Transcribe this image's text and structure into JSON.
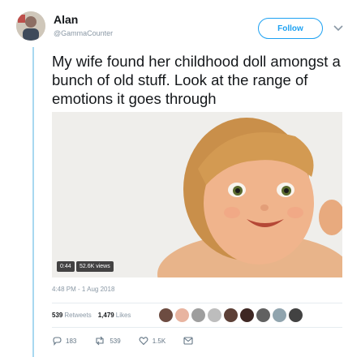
{
  "user": {
    "name": "Alan",
    "handle": "@GammaCounter"
  },
  "follow_label": "Follow",
  "tweet": {
    "text": "My wife found her childhood doll amongst a bunch of old stuff. Look at the range of emotions it goes through"
  },
  "video": {
    "duration": "0:44",
    "views": "52.6K views"
  },
  "timestamp": "4:48 PM - 1 Aug 2018",
  "stats": {
    "retweets_count": "539",
    "retweets_label": "Retweets",
    "likes_count": "1,479",
    "likes_label": "Likes"
  },
  "likers": [
    {
      "color": "#6d4c41"
    },
    {
      "color": "#e8b4a0"
    },
    {
      "color": "#9e9e9e"
    },
    {
      "color": "#bdbdbd"
    },
    {
      "color": "#5d4037"
    },
    {
      "color": "#3e2723"
    },
    {
      "color": "#616161"
    },
    {
      "color": "#90a4ae"
    },
    {
      "color": "#424242"
    }
  ],
  "actions": {
    "replies": "183",
    "retweets": "539",
    "likes": "1.5K"
  },
  "colors": {
    "accent": "#1da1f2",
    "thread_line": "#a8d8f0",
    "muted": "#8a98a5"
  }
}
